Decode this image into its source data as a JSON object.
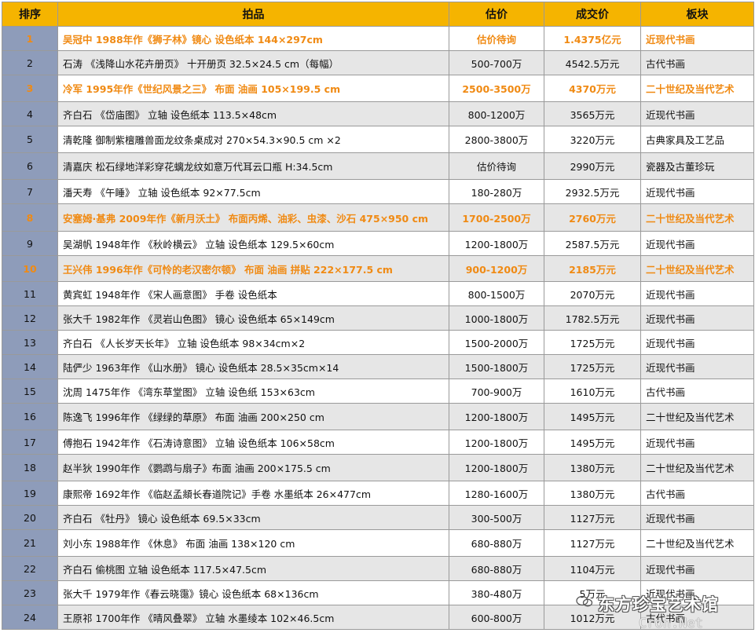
{
  "colors": {
    "header_bg": "#f5b400",
    "rank_bg": "#8e9cba",
    "highlight_text": "#f08a13",
    "even_row_bg": "#e6e6e6"
  },
  "headers": {
    "rank": "排序",
    "item": "拍品",
    "estimate": "估价",
    "price": "成交价",
    "category": "板块"
  },
  "rows": [
    {
      "rank": "1",
      "item": "吴冠中 1988年作《狮子林》镜心 设色纸本 144×297cm",
      "estimate": "估价待询",
      "price": "1.4375亿元",
      "category": "近现代书画",
      "highlight": true
    },
    {
      "rank": "2",
      "item": "石涛 《浅降山水花卉册页》 十开册页 32.5×24.5 cm（每幅）",
      "estimate": "500-700万",
      "price": "4542.5万元",
      "category": "古代书画",
      "highlight": false
    },
    {
      "rank": "3",
      "item": "冷军 1995年作《世纪风景之三》  布面 油画  105×199.5 cm",
      "estimate": "2500-3500万",
      "price": "4370万元",
      "category": "二十世纪及当代艺术",
      "highlight": true
    },
    {
      "rank": "4",
      "item": "齐白石 《岱庙图》 立轴 设色纸本 113.5×48cm",
      "estimate": "800-1200万",
      "price": "3565万元",
      "category": "近现代书画",
      "highlight": false
    },
    {
      "rank": "5",
      "item": "清乾隆 御制紫檀雕兽面龙纹条桌成对  270×54.3×90.5 cm ×2",
      "estimate": "2800-3800万",
      "price": "3220万元",
      "category": "古典家具及工艺品",
      "highlight": false
    },
    {
      "rank": "6",
      "item": "清嘉庆 松石绿地洋彩穿花螭龙纹如意万代耳云口瓶   H:34.5cm",
      "estimate": "估价待询",
      "price": "2990万元",
      "category": "瓷器及古董珍玩",
      "highlight": false
    },
    {
      "rank": "7",
      "item": "潘天寿 《午睡》 立轴 设色纸本 92×77.5cm",
      "estimate": "180-280万",
      "price": "2932.5万元",
      "category": "近现代书画",
      "highlight": false
    },
    {
      "rank": "8",
      "item": "安塞姆·基弗 2009年作《新月沃土》 布面丙烯、油彩、虫漆、沙石 475×950 cm",
      "estimate": "1700-2500万",
      "price": "2760万元",
      "category": "二十世纪及当代艺术",
      "highlight": true
    },
    {
      "rank": "9",
      "item": "吴湖帆 1948年作 《秋岭横云》 立轴 设色纸本 129.5×60cm",
      "estimate": "1200-1800万",
      "price": "2587.5万元",
      "category": "近现代书画",
      "highlight": false
    },
    {
      "rank": "10",
      "item": "王兴伟 1996年作《可怜的老汉密尔顿》 布面 油画 拼贴  222×177.5 cm",
      "estimate": "900-1200万",
      "price": "2185万元",
      "category": "二十世纪及当代艺术",
      "highlight": true
    },
    {
      "rank": "11",
      "item": "黄宾虹 1948年作 《宋人画意图》 手卷 设色纸本",
      "estimate": "800-1500万",
      "price": "2070万元",
      "category": "近现代书画",
      "highlight": false
    },
    {
      "rank": "12",
      "item": "张大千 1982年作 《灵岩山色图》 镜心 设色纸本 65×149cm",
      "estimate": "1000-1800万",
      "price": "1782.5万元",
      "category": "近现代书画",
      "highlight": false
    },
    {
      "rank": "13",
      "item": "齐白石 《人长岁天长年》 立轴 设色纸本 98×34cm×2",
      "estimate": "1500-2000万",
      "price": "1725万元",
      "category": "近现代书画",
      "highlight": false
    },
    {
      "rank": "14",
      "item": "陆俨少 1963年作 《山水册》 镜心 设色纸本 28.5×35cm×14",
      "estimate": "1500-1800万",
      "price": "1725万元",
      "category": "近现代书画",
      "highlight": false
    },
    {
      "rank": "15",
      "item": "沈周 1475年作 《湾东草堂图》 立轴 设色纸  153×63cm",
      "estimate": "700-900万",
      "price": "1610万元",
      "category": "古代书画",
      "highlight": false
    },
    {
      "rank": "16",
      "item": "陈逸飞 1996年作 《绿绿的草原》  布面 油画  200×250 cm",
      "estimate": "1200-1800万",
      "price": "1495万元",
      "category": "二十世纪及当代艺术",
      "highlight": false
    },
    {
      "rank": "17",
      "item": "傅抱石 1942年作 《石涛诗意图》 立轴 设色纸本  106×58cm",
      "estimate": "1200-1800万",
      "price": "1495万元",
      "category": "近现代书画",
      "highlight": false
    },
    {
      "rank": "18",
      "item": "赵半狄 1990年作 《鹦鹉与扇子》布面 油画   200×175.5 cm",
      "estimate": "1200-1800万",
      "price": "1380万元",
      "category": "二十世纪及当代艺术",
      "highlight": false
    },
    {
      "rank": "19",
      "item": "康熙帝 1692年作 《临赵孟頫长春道院记》手卷 水墨纸本 26×477cm",
      "estimate": "1280-1600万",
      "price": "1380万元",
      "category": "古代书画",
      "highlight": false
    },
    {
      "rank": "20",
      "item": "齐白石 《牡丹》 镜心 设色纸本  69.5×33cm",
      "estimate": "300-500万",
      "price": "1127万元",
      "category": "近现代书画",
      "highlight": false
    },
    {
      "rank": "21",
      "item": "刘小东 1988年作 《休息》  布面 油画   138×120 cm",
      "estimate": "680-880万",
      "price": "1127万元",
      "category": "二十世纪及当代艺术",
      "highlight": false
    },
    {
      "rank": "22",
      "item": "齐白石 偷桃图 立轴 设色纸本 117.5×47.5cm",
      "estimate": "680-880万",
      "price": "1104万元",
      "category": "近现代书画",
      "highlight": false
    },
    {
      "rank": "23",
      "item": "张大千 1979年作《春云晓霭》镜心 设色纸本  68×136cm",
      "estimate": "380-480万",
      "price": "5万元",
      "category": "近现代书画",
      "highlight": false
    },
    {
      "rank": "24",
      "item": "王原祁 1700年作 《晴风叠翠》 立轴 水墨绫本  102×46.5cm",
      "estimate": "600-800万",
      "price": "1012万元",
      "category": "古代书画",
      "highlight": false
    }
  ],
  "watermark": {
    "name": "东方珍宝艺术馆",
    "url": "Cron.Net"
  }
}
